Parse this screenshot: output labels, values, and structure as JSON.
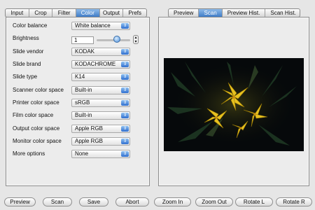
{
  "left_tabs": [
    "Input",
    "Crop",
    "Filter",
    "Color",
    "Output",
    "Prefs"
  ],
  "left_active_tab": "Color",
  "right_tabs": [
    "Preview",
    "Scan",
    "Preview Hist.",
    "Scan Hist."
  ],
  "right_active_tab": "Scan",
  "settings": {
    "color_balance": {
      "label": "Color balance",
      "value": "White balance"
    },
    "brightness": {
      "label": "Brightness",
      "value": "1"
    },
    "slide_vendor": {
      "label": "Slide vendor",
      "value": "KODAK"
    },
    "slide_brand": {
      "label": "Slide brand",
      "value": "KODACHROME"
    },
    "slide_type": {
      "label": "Slide type",
      "value": "K14"
    },
    "scanner_color_space": {
      "label": "Scanner color space",
      "value": "Built-in"
    },
    "printer_color_space": {
      "label": "Printer color space",
      "value": "sRGB"
    },
    "film_color_space": {
      "label": "Film color space",
      "value": "Built-in"
    },
    "output_color_space": {
      "label": "Output color space",
      "value": "Apple RGB"
    },
    "monitor_color_space": {
      "label": "Monitor color space",
      "value": "Apple RGB"
    },
    "more_options": {
      "label": "More options",
      "value": "None"
    }
  },
  "brightness_level": 0.6,
  "bottom_buttons": [
    "Preview",
    "Scan",
    "Save",
    "Abort",
    "Zoom In",
    "Zoom Out",
    "Rotate L",
    "Rotate R"
  ],
  "colors": {
    "accent": "#3f7cc7",
    "window_bg": "#e6e6e6",
    "image_bg": "#05080a"
  }
}
